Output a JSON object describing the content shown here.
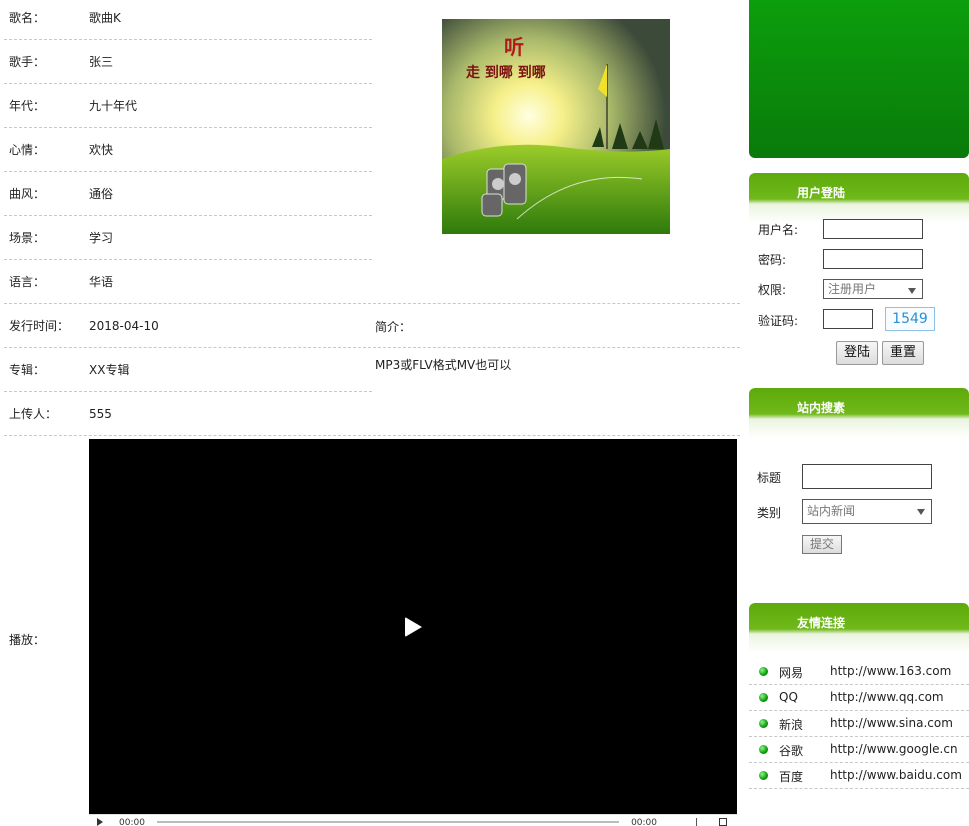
{
  "details": [
    {
      "label": "歌名：",
      "value": "歌曲K"
    },
    {
      "label": "歌手：",
      "value": "张三"
    },
    {
      "label": "年代：",
      "value": "九十年代"
    },
    {
      "label": "心情：",
      "value": "欢快"
    },
    {
      "label": "曲风：",
      "value": "通俗"
    },
    {
      "label": "场景：",
      "value": "学习"
    },
    {
      "label": "语言：",
      "value": "华语"
    },
    {
      "label": "发行时间：",
      "value": "2018-04-10"
    },
    {
      "label": "专辑：",
      "value": "XX专辑"
    },
    {
      "label": "上传人：",
      "value": "555"
    }
  ],
  "intro": {
    "label": "简介：",
    "text": "MP3或FLV格式MV也可以"
  },
  "player": {
    "label": "播放：",
    "current_time": "00:00",
    "duration": "00:00"
  },
  "cover": {
    "title_char": "听",
    "subtitle": "走 到哪 到哪"
  },
  "login": {
    "header": "用户登陆",
    "username_label": "用户名:",
    "password_label": "密码:",
    "role_label": "权限:",
    "role_selected": "注册用户",
    "captcha_label": "验证码:",
    "captcha_code": "1549",
    "login_button": "登陆",
    "reset_button": "重置"
  },
  "search": {
    "header": "站内搜素",
    "title_label": "标题",
    "category_label": "类别",
    "category_selected": "站内新闻",
    "submit_button": "提交"
  },
  "links": {
    "header": "友情连接",
    "items": [
      {
        "name": "网易",
        "url": "http://www.163.com"
      },
      {
        "name": "QQ",
        "url": "http://www.qq.com"
      },
      {
        "name": "新浪",
        "url": "http://www.sina.com"
      },
      {
        "name": "谷歌",
        "url": "http://www.google.cn"
      },
      {
        "name": "百度",
        "url": "http://www.baidu.com"
      }
    ]
  }
}
